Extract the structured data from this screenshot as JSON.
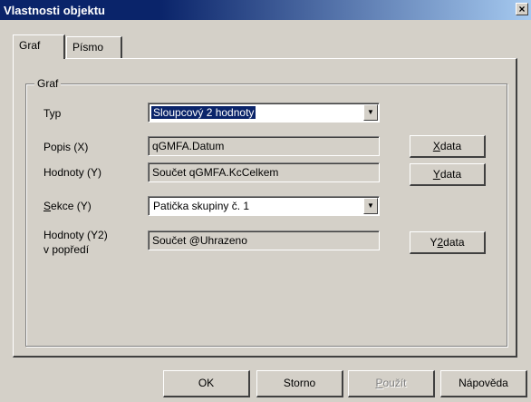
{
  "window": {
    "title": "Vlastnosti objektu",
    "close": "×"
  },
  "tabs": [
    {
      "label": "Graf"
    },
    {
      "label": "Písmo"
    }
  ],
  "group": {
    "legend": "Graf"
  },
  "form": {
    "typ_label": "Typ",
    "typ_value": "Sloupcový 2 hodnoty",
    "popis_label": "Popis (X)",
    "popis_value": "qGMFA.Datum",
    "hodnoty_label": "Hodnoty (Y)",
    "hodnoty_value": "Součet qGMFA.KcCelkem",
    "sekce_label_rest": "ekce (Y)",
    "sekce_label_ul": "S",
    "sekce_value": "Patička skupiny č. 1",
    "y2_label_line1": "Hodnoty  (Y2)",
    "y2_label_line2": "v popředí",
    "y2_value": "Součet @Uhrazeno"
  },
  "side_buttons": {
    "x_ul": "X",
    "x_rest": " data",
    "y_ul": "Y",
    "y_rest": " data",
    "y2_pre": "Y",
    "y2_ul": "2",
    "y2_rest": " data"
  },
  "footer": {
    "ok": "OK",
    "storno": "Storno",
    "pouzit_ul": "P",
    "pouzit_rest": "oužít",
    "napoveda": "Nápověda"
  }
}
